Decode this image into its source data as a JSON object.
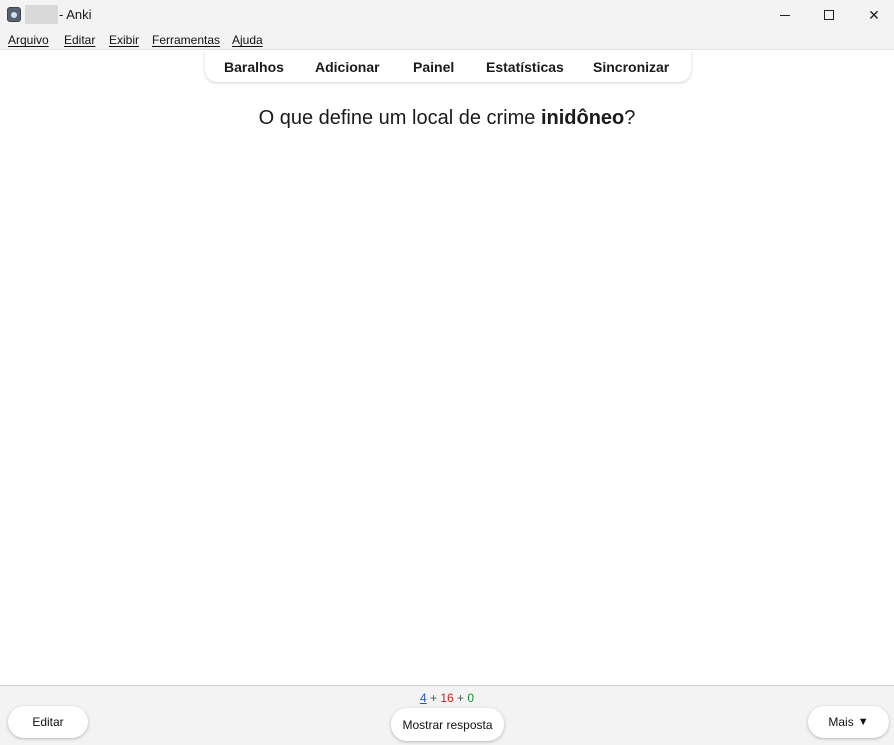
{
  "window": {
    "app_name": "- Anki",
    "controls": {
      "minimize": "minimize",
      "maximize": "maximize",
      "close": "✕"
    }
  },
  "menubar": {
    "items": [
      "Arquivo",
      "Editar",
      "Exibir",
      "Ferramentas",
      "Ajuda"
    ]
  },
  "toolbar": {
    "links": [
      "Baralhos",
      "Adicionar",
      "Painel",
      "Estatísticas",
      "Sincronizar"
    ]
  },
  "card": {
    "question_before": "O que define um local de crime ",
    "question_bold": "inidôneo",
    "question_after": "?"
  },
  "bottom": {
    "counts": {
      "new": "4",
      "sep1": " + ",
      "learn": "16",
      "sep2": " + ",
      "review": "0"
    },
    "colors": {
      "new": "#2255cc",
      "learn": "#cc2222",
      "review": "#1b8c3a"
    },
    "edit_label": "Editar",
    "show_answer_label": "Mostrar resposta",
    "more_label": "Mais",
    "more_icon": "▼"
  }
}
